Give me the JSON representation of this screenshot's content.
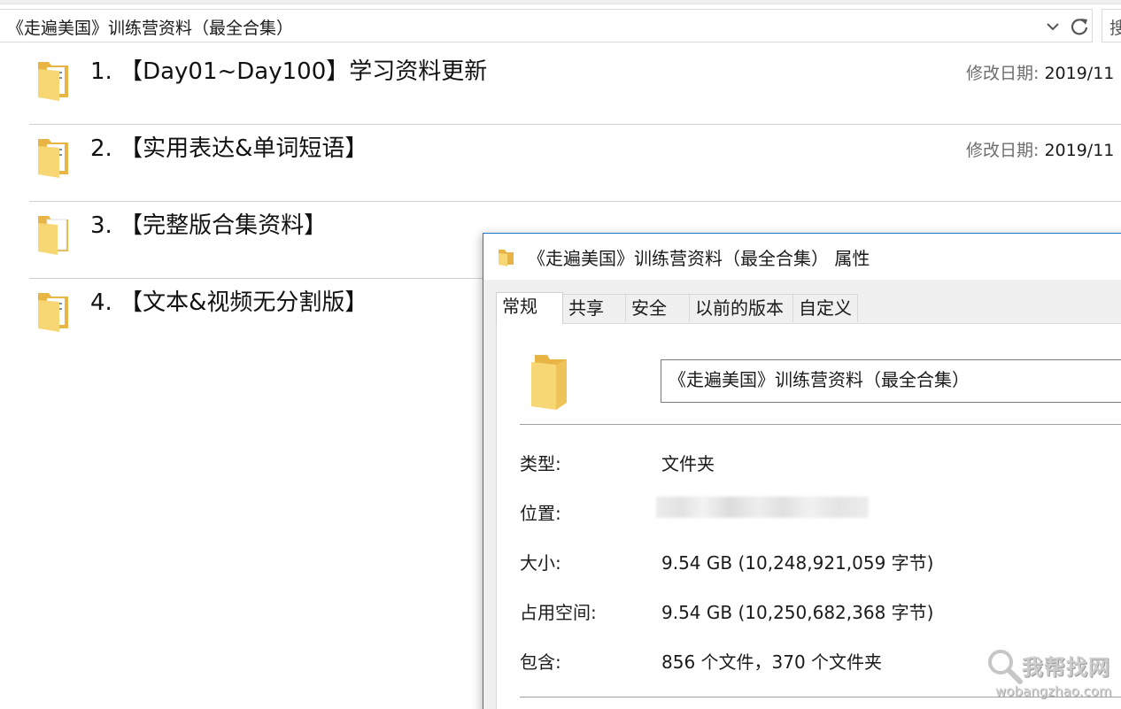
{
  "address_bar": {
    "path": "《走遍美国》训练营资料（最全合集）",
    "search_placeholder": "搜"
  },
  "folder_list": {
    "date_label": "修改日期:",
    "items": [
      {
        "title": "1. 【Day01~Day100】学习资料更新",
        "date": "2019/11"
      },
      {
        "title": "2. 【实用表达&单词短语】",
        "date": "2019/11"
      },
      {
        "title": "3. 【完整版合集资料】",
        "date": ""
      },
      {
        "title": "4. 【文本&视频无分割版】",
        "date": ""
      }
    ]
  },
  "dialog": {
    "title": "《走遍美国》训练营资料（最全合集） 属性",
    "tabs": [
      "常规",
      "共享",
      "安全",
      "以前的版本",
      "自定义"
    ],
    "active_tab": "常规",
    "name_value": "《走遍美国》训练营资料（最全合集）",
    "properties": {
      "type_label": "类型:",
      "type_value": "文件夹",
      "location_label": "位置:",
      "size_label": "大小:",
      "size_value": "9.54 GB (10,248,921,059 字节)",
      "disk_label": "占用空间:",
      "disk_value": "9.54 GB (10,250,682,368 字节)",
      "contains_label": "包含:",
      "contains_value": "856 个文件，370 个文件夹"
    }
  },
  "watermark": {
    "text": "我帮找网",
    "url": "wobangzhao.com"
  },
  "colors": {
    "dialog_border": "#1979ca",
    "folder_yellow": "#f7d774",
    "folder_dark": "#e8b545"
  }
}
